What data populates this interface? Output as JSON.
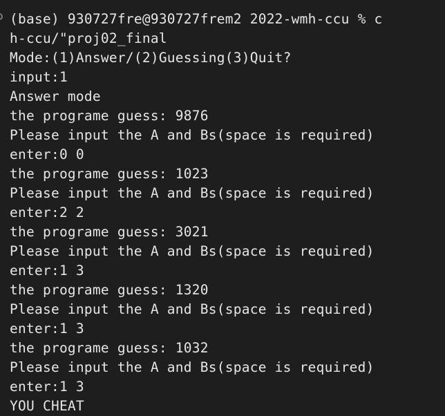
{
  "terminal": {
    "lines": [
      "(base) 930727fre@930727frem2 2022-wmh-ccu % c",
      "h-ccu/\"proj02_final",
      "Mode:(1)Answer/(2)Guessing(3)Quit?",
      "input:1",
      "Answer mode",
      "the programe guess: 9876",
      "Please input the A and Bs(space is required)",
      "enter:0 0",
      "the programe guess: 1023",
      "Please input the A and Bs(space is required)",
      "enter:2 2",
      "the programe guess: 3021",
      "Please input the A and Bs(space is required)",
      "enter:1 3",
      "the programe guess: 1320",
      "Please input the A and Bs(space is required)",
      "enter:1 3",
      "the programe guess: 1032",
      "Please input the A and Bs(space is required)",
      "enter:1 3",
      "YOU CHEAT"
    ]
  }
}
